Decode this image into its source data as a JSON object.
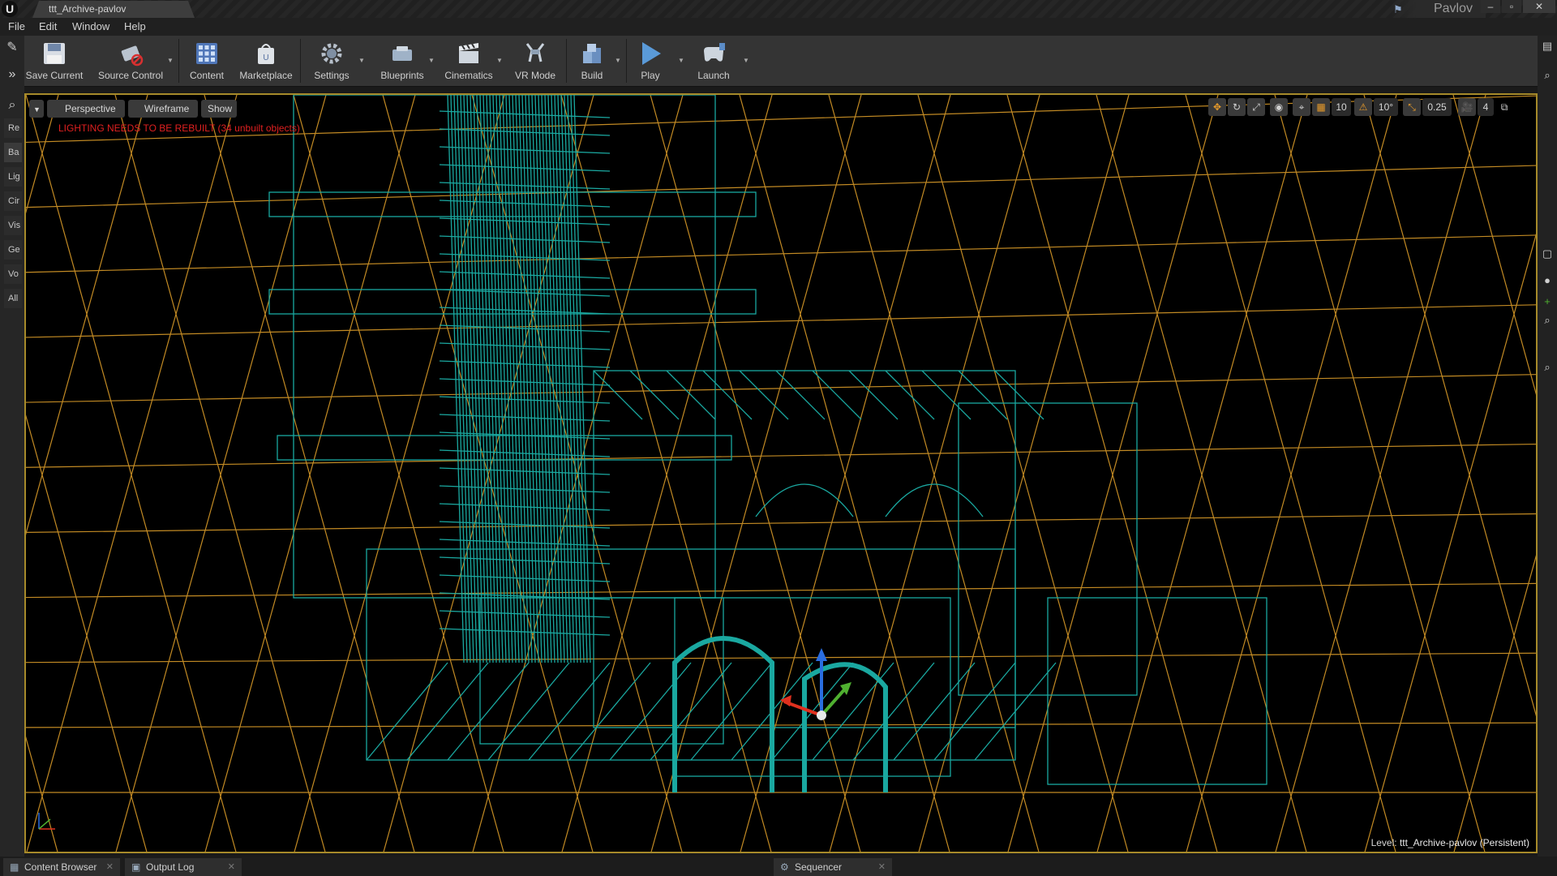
{
  "app": {
    "logo": "U",
    "document_tab": "ttt_Archive-pavlov",
    "project_name": "Pavlov"
  },
  "menu": [
    "File",
    "Edit",
    "Window",
    "Help"
  ],
  "toolbar": [
    {
      "label": "Save Current",
      "icon": "save-icon",
      "dropdown": false
    },
    {
      "label": "Source Control",
      "icon": "source-control-icon",
      "dropdown": true
    },
    {
      "label": "Content",
      "icon": "content-icon",
      "dropdown": false
    },
    {
      "label": "Marketplace",
      "icon": "marketplace-icon",
      "dropdown": false
    },
    {
      "label": "Settings",
      "icon": "settings-icon",
      "dropdown": true
    },
    {
      "label": "Blueprints",
      "icon": "blueprints-icon",
      "dropdown": true
    },
    {
      "label": "Cinematics",
      "icon": "cinematics-icon",
      "dropdown": true
    },
    {
      "label": "VR Mode",
      "icon": "vr-mode-icon",
      "dropdown": false
    },
    {
      "label": "Build",
      "icon": "build-icon",
      "dropdown": true
    },
    {
      "label": "Play",
      "icon": "play-icon",
      "dropdown": true
    },
    {
      "label": "Launch",
      "icon": "launch-icon",
      "dropdown": true
    }
  ],
  "modes_panel": {
    "tabs": [
      "Re",
      "Ba",
      "Lig",
      "Cir",
      "Vis",
      "Ge",
      "Vo",
      "All"
    ]
  },
  "viewport": {
    "view_buttons": [
      "Perspective",
      "Wireframe",
      "Show"
    ],
    "warning": "LIGHTING NEEDS TO BE REBUILT (34 unbuilt objects)",
    "grid_snap": "10",
    "rotation_snap": "10°",
    "scale_snap": "0.25",
    "camera_speed": "4",
    "level_label": "Level:",
    "level_name": "ttt_Archive-pavlov (Persistent)"
  },
  "bottom_tabs": [
    "Content Browser",
    "Output Log",
    "Sequencer"
  ],
  "colors": {
    "wireframe_geometry": "#1aa8a0",
    "grid_lines": "#d89a28",
    "warning_text": "#e02020",
    "viewport_border": "#a68a2a"
  }
}
